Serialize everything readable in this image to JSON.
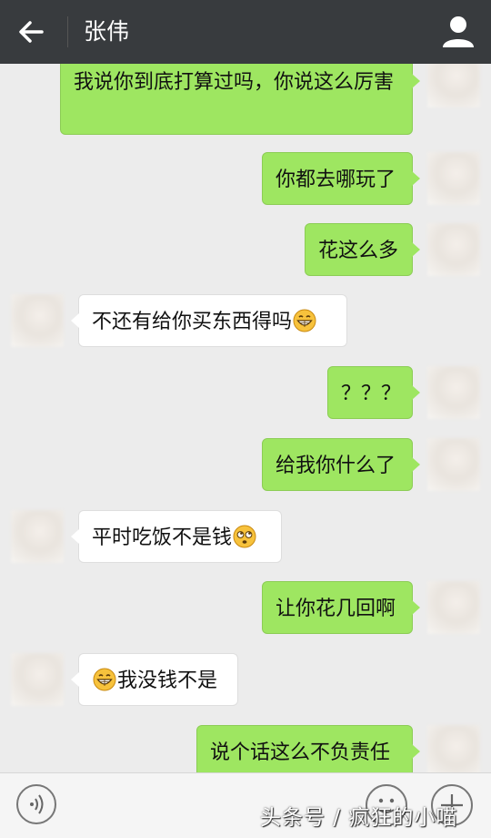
{
  "header": {
    "title": "张伟",
    "back_icon": "arrow-left-icon",
    "profile_icon": "person-icon"
  },
  "colors": {
    "topbar": "#383b3e",
    "chat_bg": "#ececec",
    "sent_bubble": "#9ee661",
    "received_bubble": "#ffffff"
  },
  "messages": [
    {
      "side": "sent",
      "text": "我说你到底打算过吗，你说这么厉害"
    },
    {
      "side": "sent",
      "text": "你都去哪玩了"
    },
    {
      "side": "sent",
      "text": "花这么多"
    },
    {
      "side": "received",
      "text": "不还有给你买东西得吗",
      "emoji_after": "grinning-face"
    },
    {
      "side": "sent",
      "text": "？？？"
    },
    {
      "side": "sent",
      "text": "给我你什么了"
    },
    {
      "side": "received",
      "text": "平时吃饭不是钱",
      "emoji_after": "rolling-eyes-face"
    },
    {
      "side": "sent",
      "text": "让你花几回啊"
    },
    {
      "side": "received",
      "text": "我没钱不是",
      "emoji_before": "grinning-face"
    },
    {
      "side": "sent",
      "text": "说个话这么不负责任"
    }
  ],
  "input_bar": {
    "voice_icon": "voice-icon",
    "emoji_icon": "emoji-icon",
    "plus_icon": "plus-icon"
  },
  "watermark": "头条号 / 疯狂的小喵"
}
